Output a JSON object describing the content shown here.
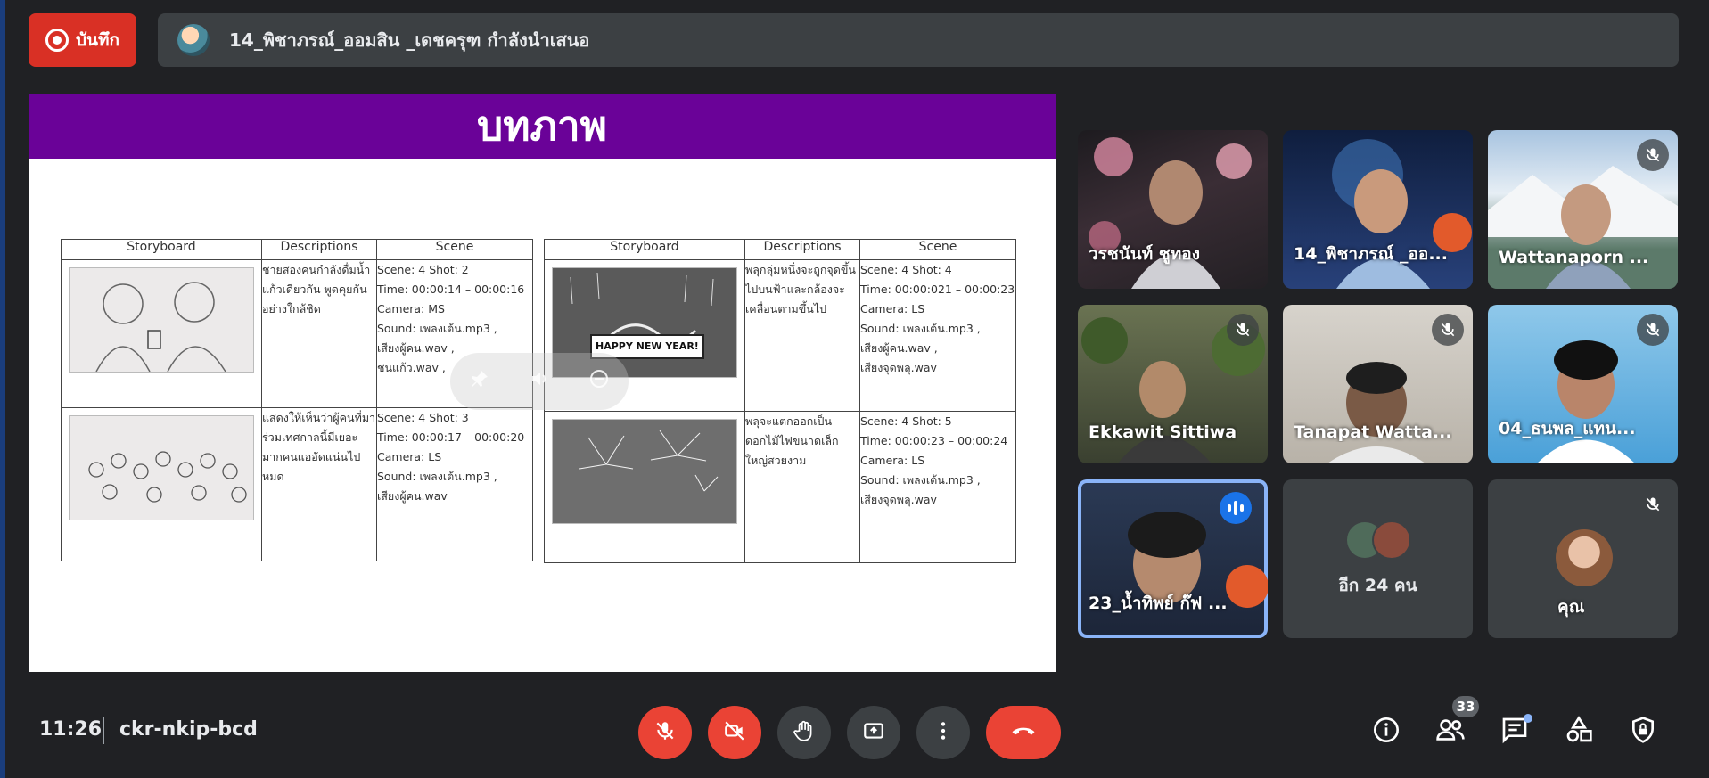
{
  "top_bar": {
    "record_label": "บันทึก",
    "presenter_text": "14_พิชาภรณ์_ออมสิน _เดชครุฑ กำลังนำเสนอ"
  },
  "slide": {
    "title": "บทภาพ",
    "left_table": {
      "headers": [
        "Storyboard",
        "Descriptions",
        "Scene"
      ],
      "rows": [
        {
          "description": "ชายสองคนกำลังดื่มน้ำแก้วเดียวกัน พูดคุยกันอย่างใกล้ชิด",
          "scene": [
            "Scene: 4 Shot: 2",
            "Time: 00:00:14 – 00:00:16",
            "Camera: MS",
            "Sound: เพลงเต้น.mp3 ,",
            "เสียงผู้คน.wav ,",
            "ชนแก้ว.wav ,"
          ]
        },
        {
          "description": "แสดงให้เห็นว่าผู้คนที่มาร่วมเทศกาลนี้มีเยอะมากคนแออัดแน่นไปหมด",
          "scene": [
            "Scene: 4 Shot: 3",
            "Time: 00:00:17 – 00:00:20",
            "Camera: LS",
            "Sound: เพลงเต้น.mp3 ,",
            "เสียงผู้คน.wav"
          ]
        }
      ]
    },
    "right_table": {
      "headers": [
        "Storyboard",
        "Descriptions",
        "Scene"
      ],
      "rows": [
        {
          "description": "พลุกลุ่มหนึ่งจะถูกจุดขึ้นไปบนฟ้าและกล้องจะเคลื่อนตามขึ้นไป",
          "image_text": "HAPPY NEW YEAR!",
          "scene": [
            "Scene: 4 Shot: 4",
            "Time: 00:00:021 – 00:00:23",
            "Camera: LS",
            "Sound: เพลงเต้น.mp3 ,",
            "เสียงผู้คน.wav ,",
            "เสียงจุดพลุ.wav"
          ]
        },
        {
          "description": "พลุจะแตกออกเป็นดอกไม้ไฟขนาดเล็กใหญ่สวยงาม",
          "scene": [
            "Scene: 4 Shot: 5",
            "Time: 00:00:23 – 00:00:24",
            "Camera: LS",
            "Sound: เพลงเต้น.mp3 ,",
            "เสียงจุดพลุ.wav"
          ]
        }
      ]
    }
  },
  "participants": [
    {
      "name": "วรชนันท์ ชูทอง",
      "muted": false
    },
    {
      "name": "14_พิชาภรณ์ _ออ...",
      "muted": false
    },
    {
      "name": "Wattanaporn ...",
      "muted": true
    },
    {
      "name": "Ekkawit Sittiwa",
      "muted": true
    },
    {
      "name": "Tanapat Watta...",
      "muted": true
    },
    {
      "name": "04_ธนพล_แทน...",
      "muted": true
    },
    {
      "name": "23_น้ำทิพย์ ก๊ฟ ...",
      "speaking": true
    },
    {
      "name": "อีก 24 คน"
    },
    {
      "name": "คุณ",
      "muted": true
    }
  ],
  "bottom_bar": {
    "time": "11:26",
    "meeting_code": "ckr-nkip-bcd",
    "people_count": "33"
  },
  "colors": {
    "background": "#202124",
    "record_red": "#d93025",
    "end_call_red": "#ea4335",
    "slide_header_purple": "#6a0298",
    "speaking_blue": "#1a73e8"
  }
}
